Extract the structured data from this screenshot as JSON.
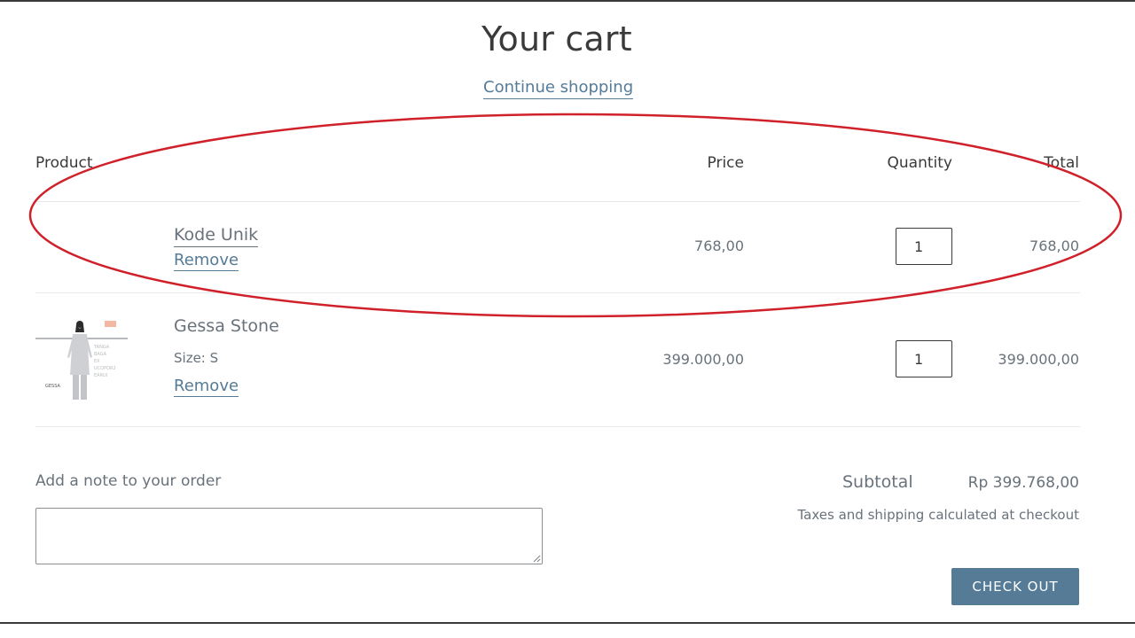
{
  "page": {
    "title": "Your cart",
    "continue_label": "Continue shopping"
  },
  "table": {
    "headers": {
      "product": "Product",
      "price": "Price",
      "quantity": "Quantity",
      "total": "Total"
    },
    "rows": [
      {
        "name": "Kode Unik",
        "remove_label": "Remove",
        "price": "768,00",
        "quantity": "1",
        "total": "768,00"
      },
      {
        "name": "Gessa Stone",
        "variant": "Size: S",
        "remove_label": "Remove",
        "price": "399.000,00",
        "quantity": "1",
        "total": "399.000,00",
        "thumbnail_text": "GESSA"
      }
    ]
  },
  "note": {
    "label": "Add a note to your order",
    "value": ""
  },
  "summary": {
    "subtotal_label": "Subtotal",
    "subtotal_value": "Rp 399.768,00",
    "tax_note": "Taxes and shipping calculated at checkout",
    "checkout_label": "CHECK OUT"
  },
  "colors": {
    "accent": "#557b97",
    "text": "#3a3a3a",
    "muted": "#69727b",
    "annotation": "#d0202a"
  }
}
